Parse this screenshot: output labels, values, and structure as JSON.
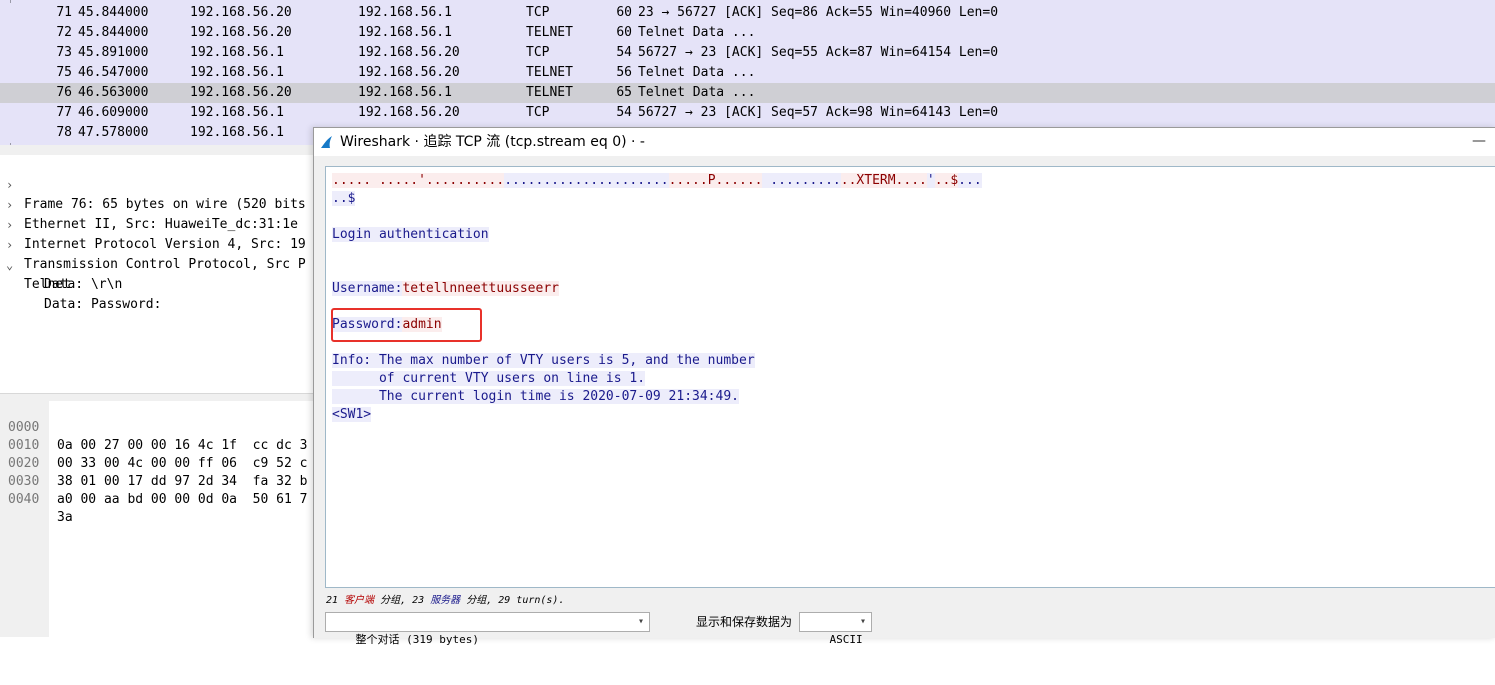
{
  "packets": [
    {
      "no": "71",
      "time": "45.844000",
      "src": "192.168.56.20",
      "dst": "192.168.56.1",
      "proto": "TCP",
      "len": "60",
      "info": "23 → 56727 [ACK] Seq=86 Ack=55 Win=40960 Len=0"
    },
    {
      "no": "72",
      "time": "45.844000",
      "src": "192.168.56.20",
      "dst": "192.168.56.1",
      "proto": "TELNET",
      "len": "60",
      "info": "Telnet Data ..."
    },
    {
      "no": "73",
      "time": "45.891000",
      "src": "192.168.56.1",
      "dst": "192.168.56.20",
      "proto": "TCP",
      "len": "54",
      "info": "56727 → 23 [ACK] Seq=55 Ack=87 Win=64154 Len=0"
    },
    {
      "no": "75",
      "time": "46.547000",
      "src": "192.168.56.1",
      "dst": "192.168.56.20",
      "proto": "TELNET",
      "len": "56",
      "info": "Telnet Data ..."
    },
    {
      "no": "76",
      "time": "46.563000",
      "src": "192.168.56.20",
      "dst": "192.168.56.1",
      "proto": "TELNET",
      "len": "65",
      "info": "Telnet Data ..."
    },
    {
      "no": "77",
      "time": "46.609000",
      "src": "192.168.56.1",
      "dst": "192.168.56.20",
      "proto": "TCP",
      "len": "54",
      "info": "56727 → 23 [ACK] Seq=57 Ack=98 Win=64143 Len=0"
    },
    {
      "no": "78",
      "time": "47.578000",
      "src": "192.168.56.1",
      "dst": "",
      "proto": "",
      "len": "",
      "info": ""
    }
  ],
  "details": {
    "frame": "Frame 76: 65 bytes on wire (520 bits",
    "ethernet": "Ethernet II, Src: HuaweiTe_dc:31:1e",
    "ip": "Internet Protocol Version 4, Src: 19",
    "tcp": "Transmission Control Protocol, Src P",
    "telnet": "Telnet",
    "data1": "Data: \\r\\n",
    "data2": "Data: Password:"
  },
  "bytes": [
    {
      "offset": "0000",
      "hex": "0a 00 27 00 00 16 4c 1f  cc dc 3"
    },
    {
      "offset": "0010",
      "hex": "00 33 00 4c 00 00 ff 06  c9 52 c"
    },
    {
      "offset": "0020",
      "hex": "38 01 00 17 dd 97 2d 34  fa 32 b"
    },
    {
      "offset": "0030",
      "hex": "a0 00 aa bd 00 00 0d 0a  50 61 7"
    },
    {
      "offset": "0040",
      "hex": "3a"
    }
  ],
  "dialog": {
    "title": "Wireshark · 追踪 TCP 流 (tcp.stream eq 0) · -",
    "minimize": "—",
    "stream": {
      "l1_client_a": "..... .....'..........",
      "l1_server_a": ".....................",
      "l1_client_b": ".....P......",
      "l1_server_b": " .........",
      "l1_client_c": "..XTERM....",
      "l1_server_c": "'",
      "l1_client_d": "..$",
      "l1_server_d": "...",
      "l2": "..$",
      "l3": "Login authentication",
      "l4_label": "Username:",
      "l4_value": "tetellnneettuusseerr",
      "l5_label": "Password:",
      "l5_value": "admin",
      "l6": "Info: The max number of VTY users is 5, and the number",
      "l7": "      of current VTY users on line is 1.",
      "l8": "      The current login time is 2020-07-09 21:34:49.",
      "l9": "<SW1>"
    },
    "stats": {
      "pre": "21 ",
      "client_word": "客户端",
      "mid1": " 分组, 23 ",
      "server_word": "服务器",
      "post": " 分组, 29 turn(s)."
    },
    "conversation_select": "整个对话 (319 bytes)",
    "format_label": "显示和保存数据为",
    "format_select": "ASCII"
  },
  "colors": {
    "client_text": "#8b0000",
    "server_text": "#1a1a8c",
    "highlight": "#e8312a",
    "packet_bg": "#e5e3f8"
  }
}
